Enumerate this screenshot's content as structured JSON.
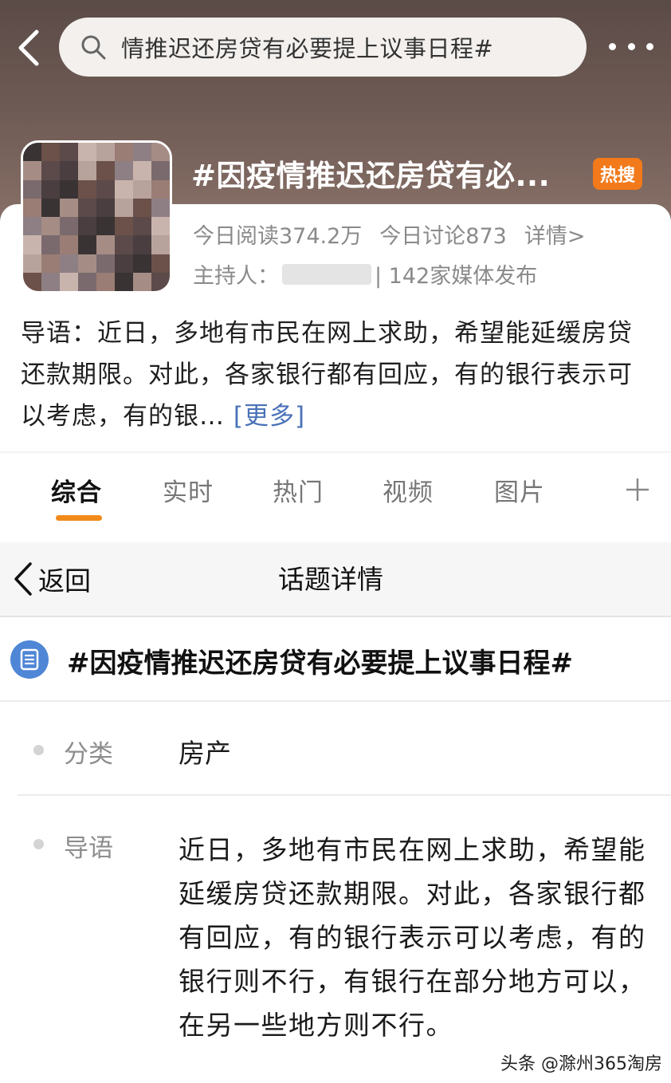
{
  "search": {
    "query": "情推迟还房贷有必要提上议事日程#"
  },
  "header": {
    "topic_title": "#因疫情推迟还房贷有必...",
    "hot_badge": "热搜",
    "reads": "今日阅读374.2万",
    "discussions": "今日讨论873",
    "details_link": "详情>",
    "host_label": "主持人：",
    "media_count": "| 142家媒体发布"
  },
  "intro": {
    "text": "导语：近日，多地有市民在网上求助，希望能延缓房贷还款期限。对此，各家银行都有回应，有的银行表示可以考虑，有的银…",
    "more_label": "[更多]"
  },
  "tabs": [
    {
      "label": "综合",
      "active": true
    },
    {
      "label": "实时",
      "active": false
    },
    {
      "label": "热门",
      "active": false
    },
    {
      "label": "视频",
      "active": false
    },
    {
      "label": "图片",
      "active": false
    }
  ],
  "detail": {
    "back_label": "返回",
    "title": "话题详情",
    "topic_full": "#因疫情推迟还房贷有必要提上议事日程#",
    "category_label": "分类",
    "category_value": "房产",
    "intro_label": "导语",
    "intro_value": "近日，多地有市民在网上求助，希望能延缓房贷还款期限。对此，各家银行都有回应，有的银行表示可以考虑，有的银行则不行，有银行在部分地方可以，在另一些地方则不行。"
  },
  "watermark": "头条 @滁州365淘房",
  "colors": {
    "accent_orange": "#f28a1a",
    "hot_badge": "#f27a1a",
    "link_blue": "#4a72b8",
    "topic_icon_blue": "#4f86d6"
  },
  "icons": [
    "back-chevron-icon",
    "search-icon",
    "more-dots-icon",
    "plus-icon",
    "topic-list-icon"
  ]
}
